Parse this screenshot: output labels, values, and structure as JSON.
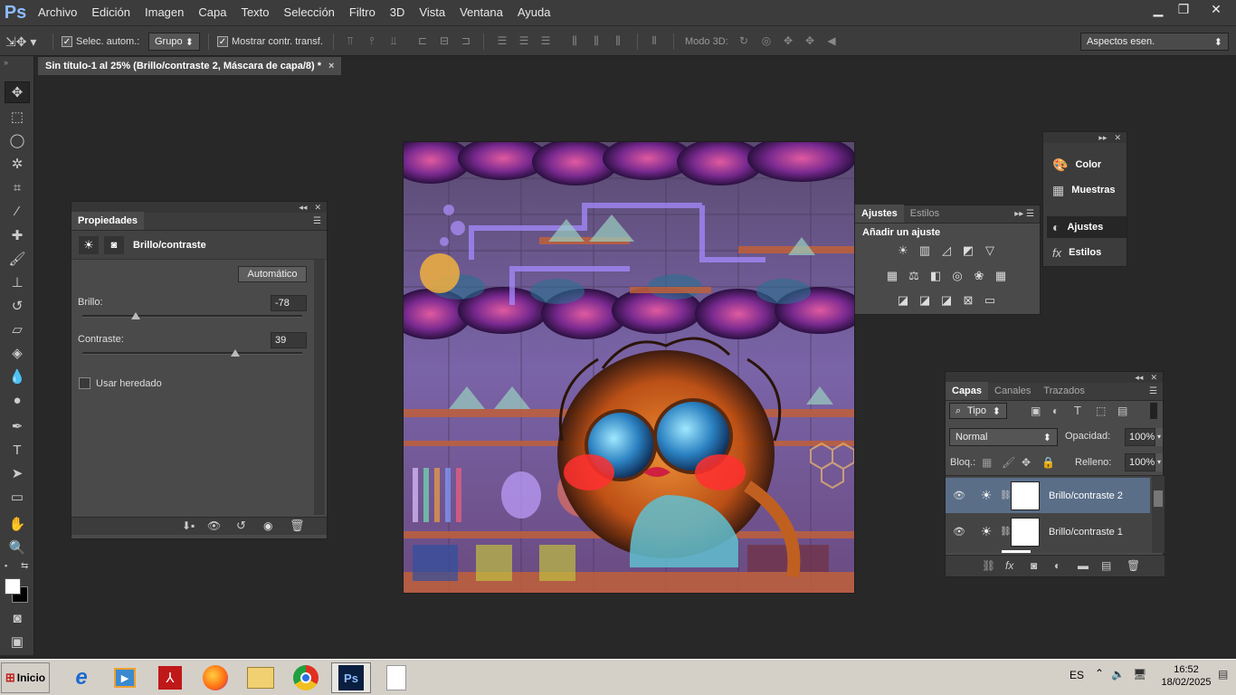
{
  "app": {
    "logo": "Ps"
  },
  "menu": [
    "Archivo",
    "Edición",
    "Imagen",
    "Capa",
    "Texto",
    "Selección",
    "Filtro",
    "3D",
    "Vista",
    "Ventana",
    "Ayuda"
  ],
  "window_controls": {
    "minimize": "▁",
    "restore": "❐",
    "close": "✕"
  },
  "options_bar": {
    "auto_select_label": "Selec. autom.:",
    "auto_select_value": "Grupo",
    "show_transform_label": "Mostrar contr. transf.",
    "mode3d_label": "Modo 3D:",
    "workspace": "Aspectos esen."
  },
  "document_tab": {
    "title": "Sin título-1 al 25% (Brillo/contraste 2, Máscara de capa/8) *",
    "close": "×"
  },
  "properties": {
    "tab": "Propiedades",
    "type_label": "Brillo/contraste",
    "auto_button": "Automático",
    "brightness_label": "Brillo:",
    "brightness_value": "-78",
    "contrast_label": "Contraste:",
    "contrast_value": "39",
    "legacy_label": "Usar heredado"
  },
  "adjustments": {
    "tabs": [
      "Ajustes",
      "Estilos"
    ],
    "heading": "Añadir un ajuste"
  },
  "side_panel": {
    "items": [
      {
        "label": "Color",
        "icon": "palette-icon"
      },
      {
        "label": "Muestras",
        "icon": "swatches-icon"
      },
      {
        "label": "Ajustes",
        "icon": "adjustments-icon"
      },
      {
        "label": "Estilos",
        "icon": "styles-icon"
      }
    ]
  },
  "layers": {
    "tabs": [
      "Capas",
      "Canales",
      "Trazados"
    ],
    "filter_kind": "Tipo",
    "blend_mode": "Normal",
    "opacity_label": "Opacidad:",
    "opacity_value": "100%",
    "lock_label": "Bloq.:",
    "fill_label": "Relleno:",
    "fill_value": "100%",
    "rows": [
      {
        "name": "Brillo/contraste 2",
        "selected": true
      },
      {
        "name": "Brillo/contraste 1",
        "selected": false
      }
    ]
  },
  "taskbar": {
    "start_label": "Inicio",
    "language": "ES",
    "time": "16:52",
    "date": "18/02/2025"
  }
}
